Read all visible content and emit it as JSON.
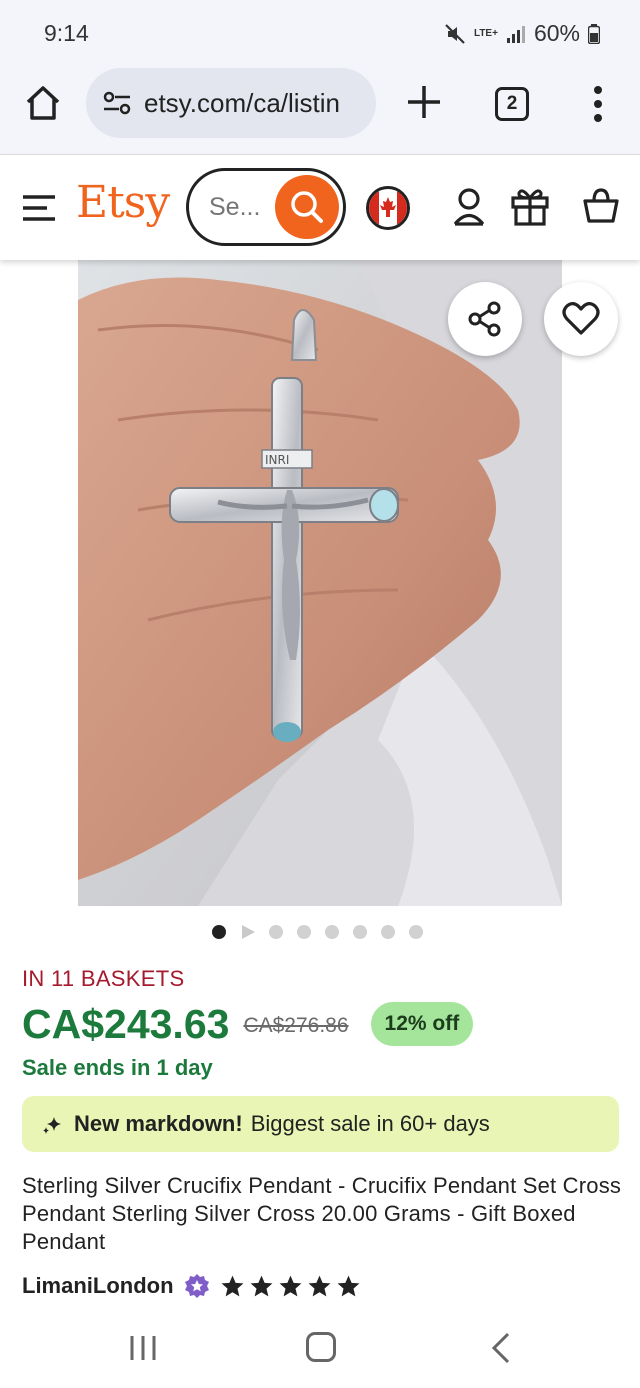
{
  "status_bar": {
    "time": "9:14",
    "network": "LTE+",
    "battery": "60%"
  },
  "browser": {
    "url": "etsy.com/ca/listin",
    "tab_count": "2"
  },
  "header": {
    "logo": "Etsy",
    "search_placeholder": "Se...",
    "icons": [
      "menu-icon",
      "search-icon",
      "canada-flag-icon",
      "account-icon",
      "gift-icon",
      "cart-icon"
    ]
  },
  "product": {
    "image_count": 8,
    "active_image": 1,
    "baskets": "IN 11 BASKETS",
    "price": "CA$243.63",
    "original_price": "CA$276.86",
    "discount": "12% off",
    "sale_ends": "Sale ends in 1 day",
    "markdown_title": "New markdown!",
    "markdown_text": "Biggest sale in 60+ days",
    "title": "Sterling Silver Crucifix Pendant - Crucifix Pendant Set Cross Pendant Sterling Silver Cross 20.00 Grams - Gift Boxed Pendant",
    "inri_label": "INRI",
    "shop_name": "LimaniLondon",
    "rating": 5
  },
  "colors": {
    "etsy_orange": "#f1641e",
    "price_green": "#1c7a3c",
    "basket_red": "#a61a2e",
    "discount_badge": "#a4e49b",
    "markdown_banner": "#e8f5b4",
    "star_seller_purple": "#7f5ec8"
  }
}
